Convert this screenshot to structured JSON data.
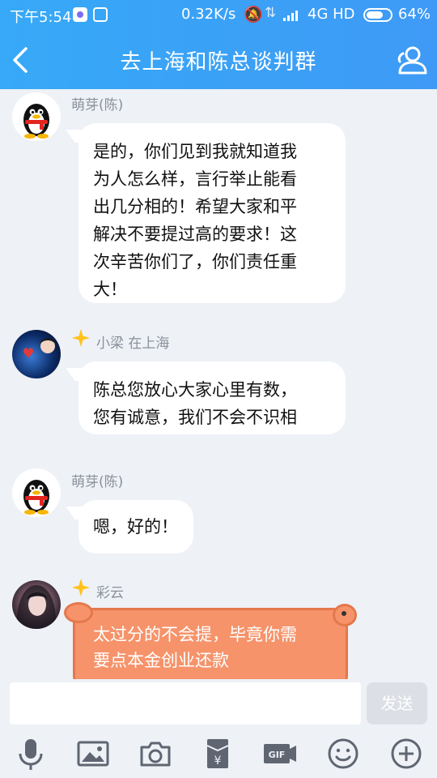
{
  "status_bar": {
    "time": "下午5:54",
    "net_speed": "0.32K/s",
    "network": "4G HD",
    "battery": "64%"
  },
  "header": {
    "title": "去上海和陈总谈判群"
  },
  "messages": [
    {
      "sender": "萌芽(陈)",
      "avatar": "qq-penguin-avatar",
      "lines": [
        "是的，你们见到我就知道我",
        "为人怎么样，言行举止能看",
        "出几分相的！希望大家和平",
        "解决不要提过高的要求！这",
        "次辛苦你们了，你们责任重",
        "大！"
      ]
    },
    {
      "sender": "小梁 在上海",
      "avatar": "photo-avatar",
      "badge": "star-icon",
      "lines": [
        "陈总您放心大家心里有数，",
        "您有诚意，我们不会不识相"
      ]
    },
    {
      "sender": "萌芽(陈)",
      "avatar": "qq-penguin-avatar",
      "lines": [
        "嗯，好的！"
      ]
    },
    {
      "sender": "彩云",
      "avatar": "photo-avatar",
      "badge": "star-icon",
      "lines": [
        "太过分的不会提，毕竟你需",
        "要点本金创业还款"
      ]
    }
  ],
  "input": {
    "placeholder": "",
    "send_label": "发送"
  },
  "toolbar": [
    "mic-icon",
    "image-icon",
    "camera-icon",
    "red-packet-icon",
    "gif-icon",
    "emoji-icon",
    "plus-icon"
  ],
  "colors": {
    "header": "#3e9af6",
    "chat_bg": "#eef1f6",
    "fancy_bubble": "#f6936a"
  }
}
